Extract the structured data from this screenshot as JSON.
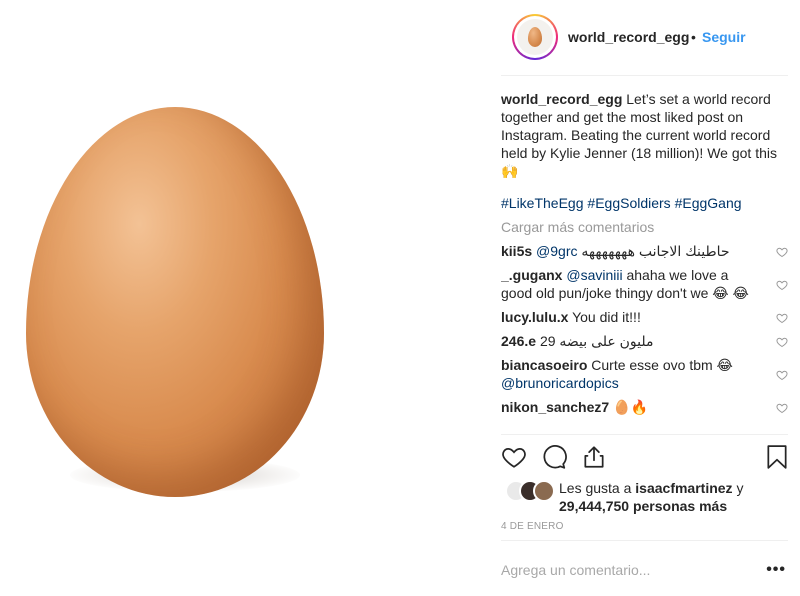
{
  "post": {
    "username": "world_record_egg",
    "dot": "•",
    "follow_label": "Seguir",
    "caption_text": "Let’s set a world record together and get the most liked post on Instagram. Beating the current world record held by Kylie Jenner (18 million)! We got this 🙌",
    "hashtags": [
      "#LikeTheEgg",
      "#EggSoldiers",
      "#EggGang"
    ],
    "load_more_label": "Cargar más comentarios"
  },
  "comments": [
    {
      "user": "kii5s",
      "mention": "@9grc",
      "text": "حاطينك الاجانب هههههههه"
    },
    {
      "user": "_.guganx",
      "mention": "@saviniii",
      "text": "ahaha we love a good old pun/joke thingy don't we 😂 😂"
    },
    {
      "user": "lucy.lulu.x",
      "mention": "",
      "text": "You did it!!!"
    },
    {
      "user": "246.e",
      "mention": "",
      "text": "مليون على بيضه 29"
    },
    {
      "user": "biancasoeiro",
      "mention": "@brunoricardopics",
      "text": "Curte esse ovo tbm 😂"
    },
    {
      "user": "nikon_sanchez7",
      "mention": "",
      "text": "🥚🔥"
    }
  ],
  "likes": {
    "prefix": "Les gusta a",
    "user": "isaacfmartinez",
    "joiner": "y",
    "count": "29,444,750 personas más"
  },
  "date": "4 DE ENERO",
  "add_comment": {
    "placeholder": "Agrega un comentario...",
    "more_label": "•••"
  },
  "icons": {
    "like": "heart-icon",
    "comment": "comment-icon",
    "share": "share-icon",
    "save": "bookmark-icon"
  },
  "colors": {
    "link_blue": "#3897f0",
    "hashtag": "#003569",
    "muted": "#999999",
    "text": "#262626"
  }
}
